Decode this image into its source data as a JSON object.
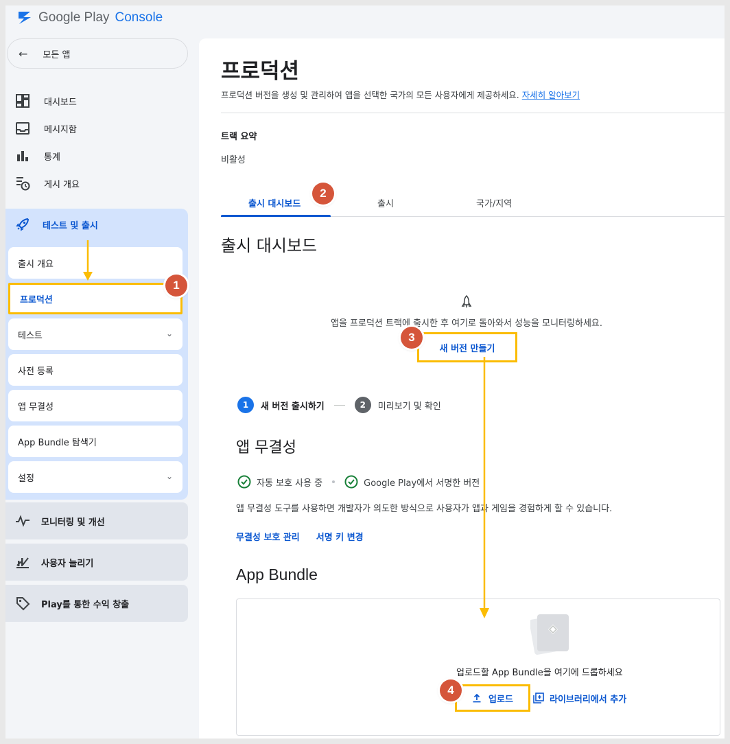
{
  "app": {
    "brand_google": "Google Play",
    "brand_console": "Console"
  },
  "sidebar": {
    "back_label": "모든 앱",
    "items": [
      {
        "label": "대시보드",
        "icon": "dashboard-icon"
      },
      {
        "label": "메시지함",
        "icon": "inbox-icon"
      },
      {
        "label": "통계",
        "icon": "bar-chart-icon"
      },
      {
        "label": "게시 개요",
        "icon": "publishing-overview-icon"
      }
    ],
    "test_section": {
      "label": "테스트 및 출시",
      "icon": "rocket-icon",
      "sub_items": [
        {
          "label": "출시 개요"
        },
        {
          "label": "프로덕션"
        },
        {
          "label": "테스트"
        },
        {
          "label": "사전 등록"
        },
        {
          "label": "앱 무결성"
        },
        {
          "label": "App Bundle 탐색기"
        },
        {
          "label": "설정"
        }
      ]
    },
    "blocks": [
      {
        "label": "모니터링 및 개선",
        "icon": "monitoring-icon"
      },
      {
        "label": "사용자 늘리기",
        "icon": "grow-users-icon"
      },
      {
        "label": "Play를 통한 수익 창출",
        "icon": "tag-icon"
      }
    ]
  },
  "main": {
    "title": "프로덕션",
    "description": "프로덕션 버전을 생성 및 관리하여 앱을 선택한 국가의 모든 사용자에게 제공하세요.",
    "learn_more": "자세히 알아보기",
    "track_summary_label": "트랙 요약",
    "track_status": "비활성",
    "tabs": [
      "출시 대시보드",
      "출시",
      "국가/지역"
    ],
    "section_title": "출시 대시보드",
    "empty_text": "앱을 프로덕션 트랙에 출시한 후 여기로 돌아와서 성능을 모니터링하세요.",
    "create_button": "새 버전 만들기",
    "steps": [
      {
        "number": "1",
        "label": "새 버전 출시하기"
      },
      {
        "number": "2",
        "label": "미리보기 및 확인"
      }
    ],
    "integrity": {
      "title": "앱 무결성",
      "checks": [
        "자동 보호 사용 중",
        "Google Play에서 서명한 버전"
      ],
      "description": "앱 무결성 도구를 사용하면 개발자가 의도한 방식으로 사용자가 앱과 게임을 경험하게 할 수 있습니다.",
      "links": [
        "무결성 보호 관리",
        "서명 키 변경"
      ]
    },
    "bundle": {
      "title": "App Bundle",
      "drop_text": "업로드할 App Bundle을 여기에 드롭하세요",
      "upload_button": "업로드",
      "library_button": "라이브러리에서 추가"
    }
  },
  "annotations": [
    "1",
    "2",
    "3",
    "4"
  ],
  "colors": {
    "accent": "#0b57d0",
    "highlight": "#fbbc04",
    "badge": "#d5553a",
    "check": "#188038"
  }
}
